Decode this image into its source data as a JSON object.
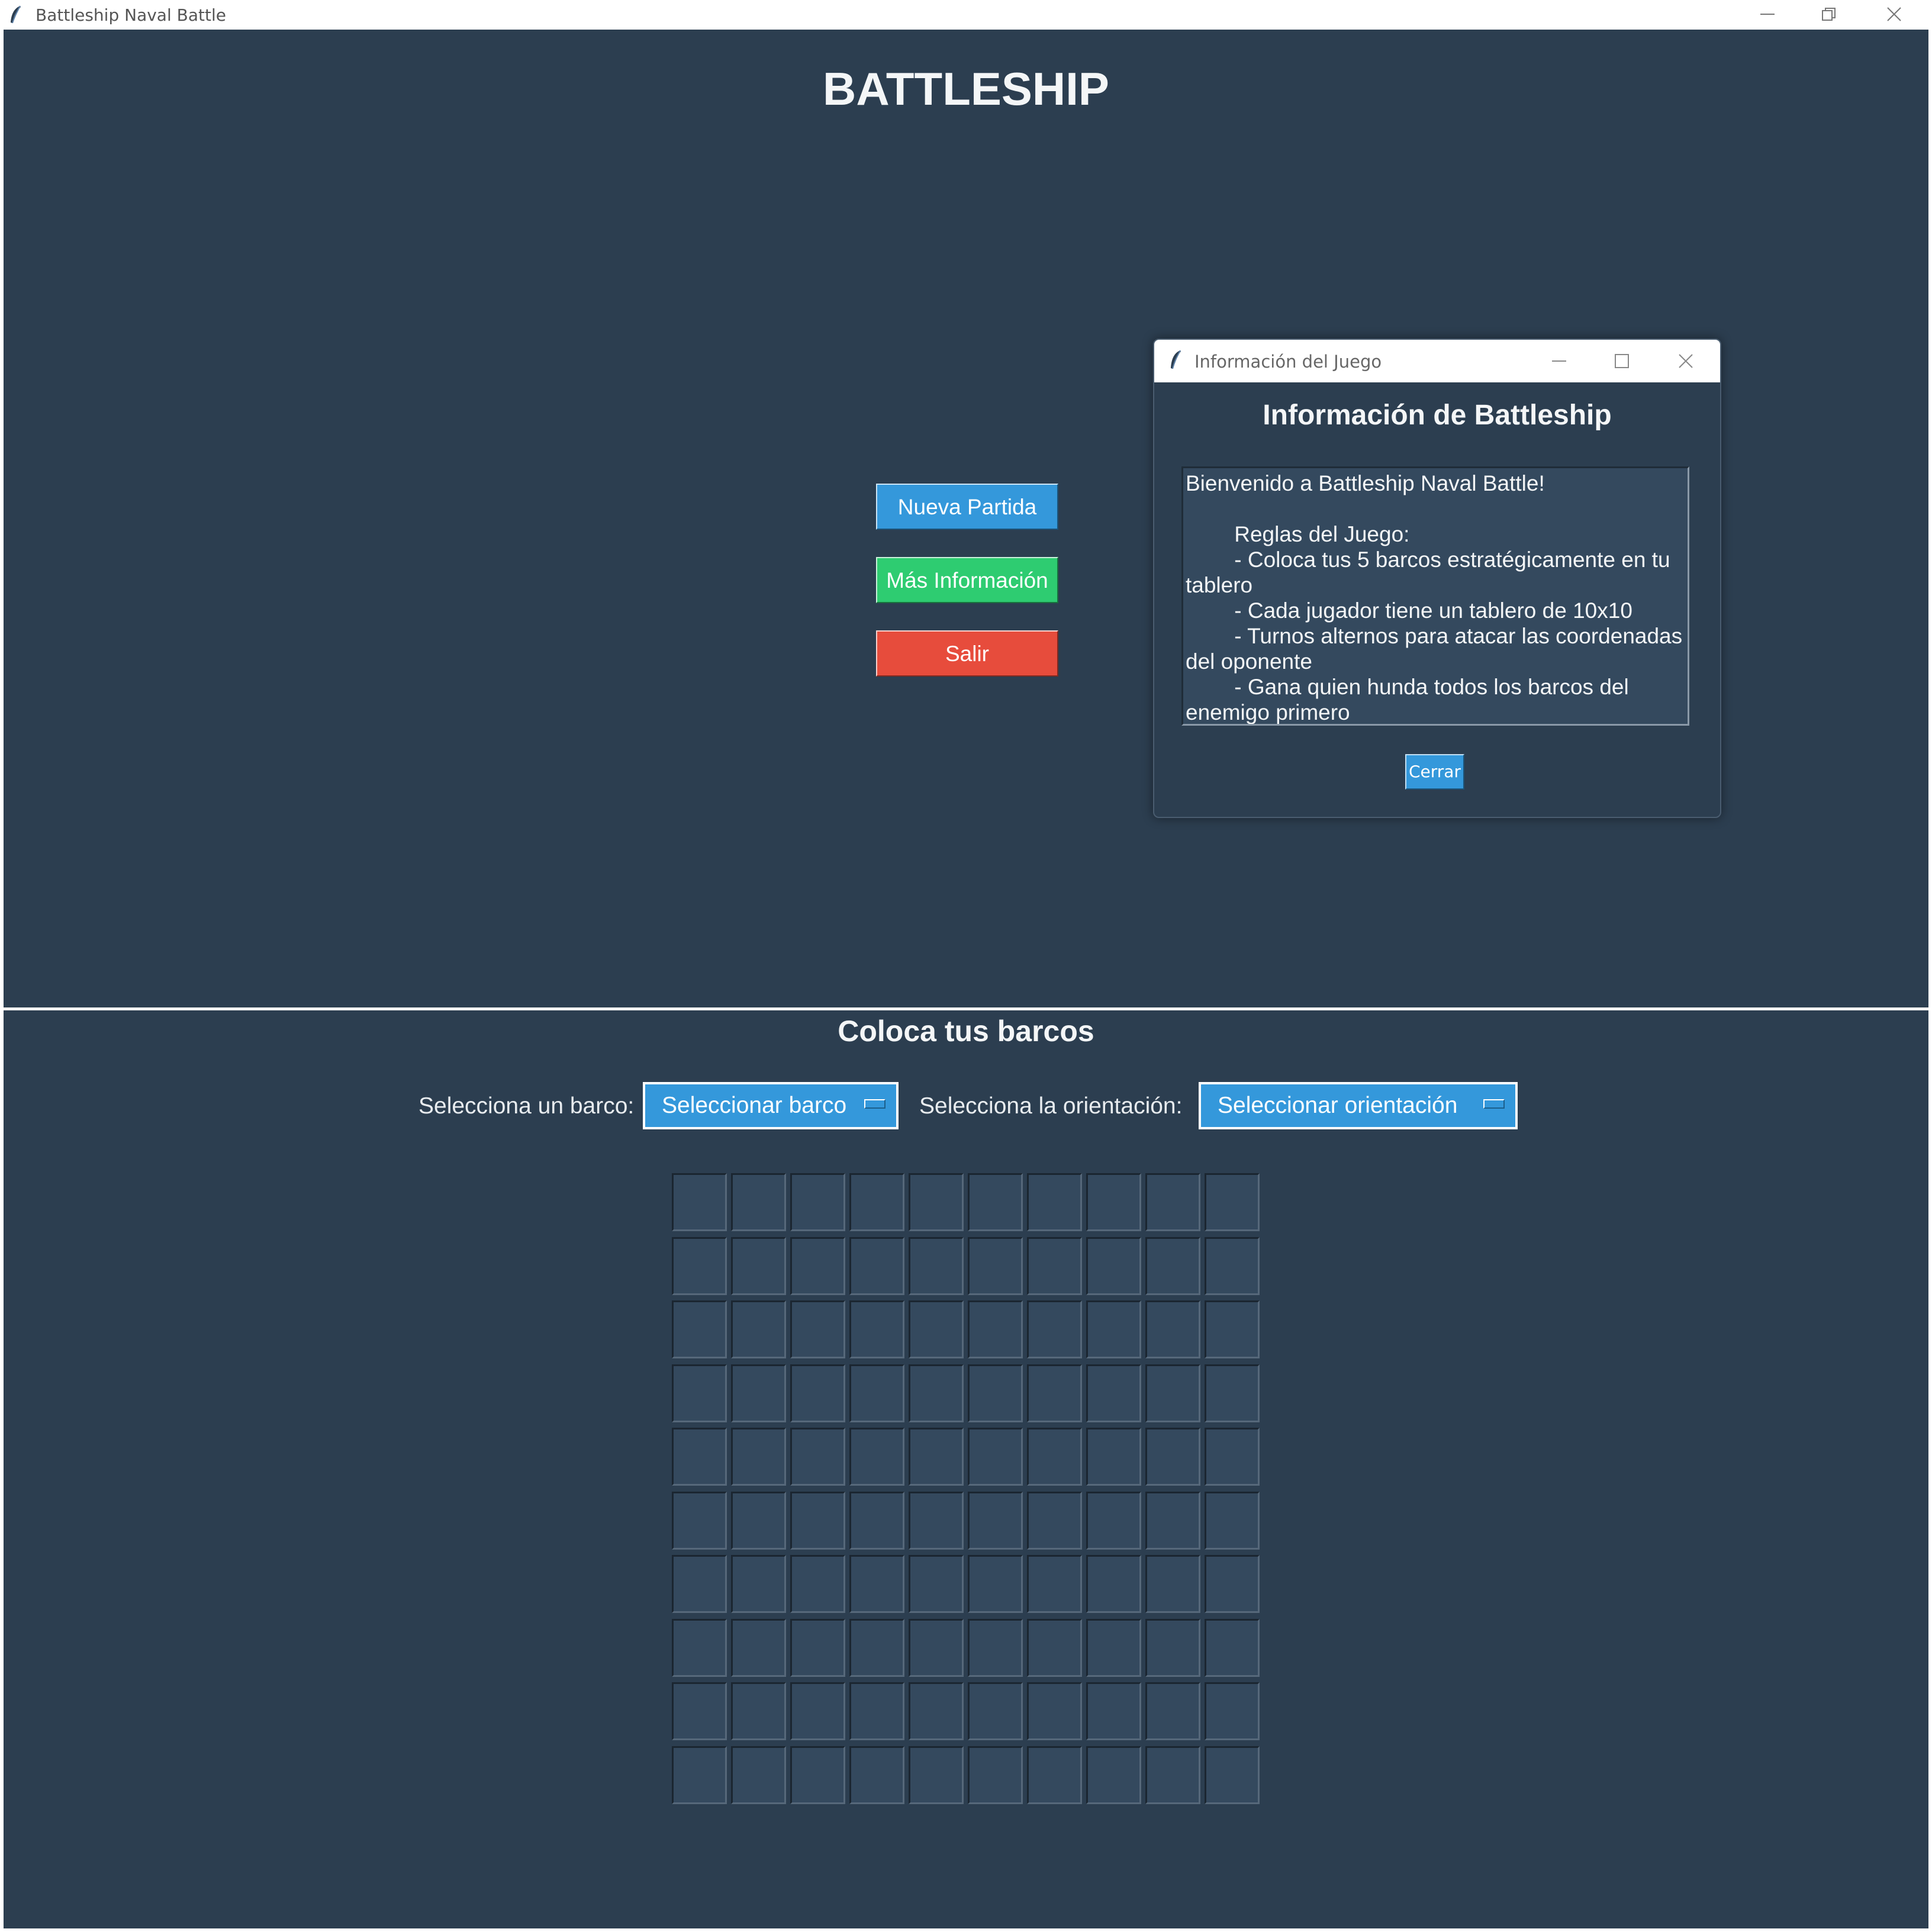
{
  "window": {
    "title": "Battleship Naval Battle",
    "colors": {
      "background": "#2c3e50",
      "text": "#f4f6f7"
    }
  },
  "main_menu": {
    "title": "BATTLESHIP",
    "buttons": {
      "new_game": {
        "label": "Nueva Partida",
        "color": "#3498db"
      },
      "more_info": {
        "label": "Más Información",
        "color": "#2ecc71"
      },
      "exit": {
        "label": "Salir",
        "color": "#e74c3c"
      }
    }
  },
  "info_dialog": {
    "window_title": "Información del Juego",
    "heading": "Información de Battleship",
    "body": "Bienvenido a Battleship Naval Battle!\n\n        Reglas del Juego:\n        - Coloca tus 5 barcos estratégicamente en tu tablero\n        - Cada jugador tiene un tablero de 10x10\n        - Turnos alternos para atacar las coordenadas del oponente\n        - Gana quien hunda todos los barcos del enemigo primero",
    "close_label": "Cerrar"
  },
  "placement": {
    "title": "Coloca tus barcos",
    "ship_label": "Selecciona un barco:",
    "ship_select_value": "Seleccionar barco",
    "orientation_label": "Selecciona la orientación:",
    "orientation_select_value": "Seleccionar orientación",
    "grid": {
      "rows": 10,
      "cols": 10
    }
  }
}
